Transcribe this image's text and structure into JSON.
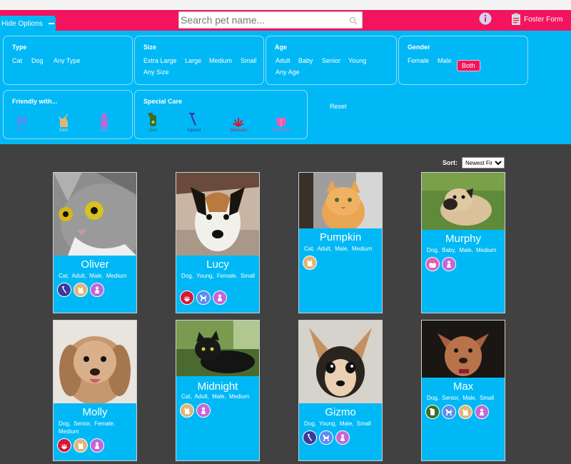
{
  "header": {
    "search_placeholder": "Search pet name...",
    "foster_label": "Foster Form"
  },
  "options": {
    "hide_label": "Hide Options",
    "type": {
      "title": "Type",
      "items": [
        "Cat",
        "Dog",
        "Any Type"
      ]
    },
    "size": {
      "title": "Size",
      "items": [
        "Extra Large",
        "Large",
        "Medium",
        "Small",
        "Any Size"
      ]
    },
    "age": {
      "title": "Age",
      "items": [
        "Adult",
        "Baby",
        "Senior",
        "Young",
        "Any Age"
      ]
    },
    "gender": {
      "title": "Gender",
      "items": [
        "Female",
        "Male",
        "Both"
      ],
      "selected": "Both"
    },
    "friendly": {
      "title": "Friendly with...",
      "items": [
        "Dogs",
        "Cats",
        "Kids"
      ]
    },
    "care": {
      "title": "Special Care",
      "items": [
        "Sick",
        "Injured",
        "Stressed",
        "Pregnant"
      ]
    },
    "reset_label": "Reset"
  },
  "sort": {
    "label": "Sort:",
    "selected": "Newest First"
  },
  "pets": [
    {
      "name": "Oliver",
      "desc": "Cat, Adult, Male, Medium",
      "badges": [
        "injured",
        "cats",
        "kids"
      ]
    },
    {
      "name": "Lucy",
      "desc": "Dog, Young, Female, Small",
      "badges": [
        "stressed",
        "dogs",
        "kids"
      ]
    },
    {
      "name": "Pumpkin",
      "desc": "Cat, Adult, Male, Medium",
      "badges": [
        "cats"
      ]
    },
    {
      "name": "Murphy",
      "desc": "Dog, Baby, Male, Medium",
      "badges": [
        "pregnant",
        "kids"
      ]
    },
    {
      "name": "Molly",
      "desc": "Dog, Senior, Female, Medium",
      "badges": [
        "stressed",
        "cats",
        "kids"
      ]
    },
    {
      "name": "Midnight",
      "desc": "Cat, Adult, Male, Medium",
      "badges": [
        "cats",
        "kids"
      ]
    },
    {
      "name": "Gizmo",
      "desc": "Dog, Young, Male, Small",
      "badges": [
        "injured",
        "dogs",
        "kids"
      ]
    },
    {
      "name": "Max",
      "desc": "Dog, Senior, Male, Small",
      "badges": [
        "sick",
        "dogs",
        "cats",
        "kids"
      ]
    }
  ],
  "colors": {
    "header": "#f2145e",
    "options": "#00b8f5",
    "background": "#414141",
    "dogs": "#5b8cf0",
    "cats": "#e0b57a",
    "kids": "#c466d8",
    "sick": "#3b6e2a",
    "injured": "#3a3a9a",
    "stressed": "#d11a3a",
    "pregnant": "#e55fb0"
  }
}
